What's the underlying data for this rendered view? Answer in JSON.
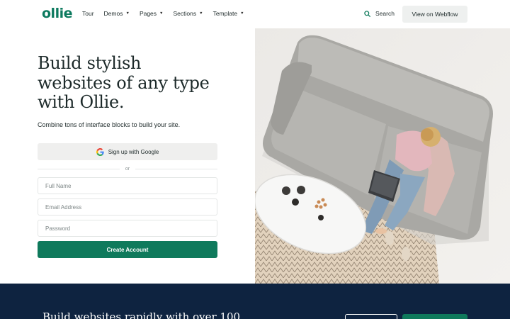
{
  "nav": {
    "logo": "ollie",
    "menu": [
      {
        "label": "Tour",
        "has_dropdown": false
      },
      {
        "label": "Demos",
        "has_dropdown": true
      },
      {
        "label": "Pages",
        "has_dropdown": true
      },
      {
        "label": "Sections",
        "has_dropdown": true
      },
      {
        "label": "Template",
        "has_dropdown": true
      }
    ],
    "search_label": "Search",
    "search_icon": "search-icon",
    "cta_label": "View on Webflow"
  },
  "hero": {
    "title_lines": [
      "Build stylish",
      "websites of any type",
      "with Ollie."
    ],
    "subtitle": "Combine tons of interface blocks to build your site.",
    "google_label": "Sign up with Google",
    "google_icon": "google-icon",
    "or_label": "or",
    "fields": {
      "full_name": {
        "placeholder": "Full Name",
        "value": ""
      },
      "email": {
        "placeholder": "Email Address",
        "value": ""
      },
      "password": {
        "placeholder": "Password",
        "value": ""
      }
    },
    "create_label": "Create Account",
    "image_description": "aerial-photo-woman-on-sofa-with-laptop"
  },
  "band": {
    "text": "Build websites rapidly with over 100"
  },
  "colors": {
    "brand_green": "#0f7a5c",
    "dark_navy": "#0e2340",
    "light_button": "#eef0ef"
  }
}
